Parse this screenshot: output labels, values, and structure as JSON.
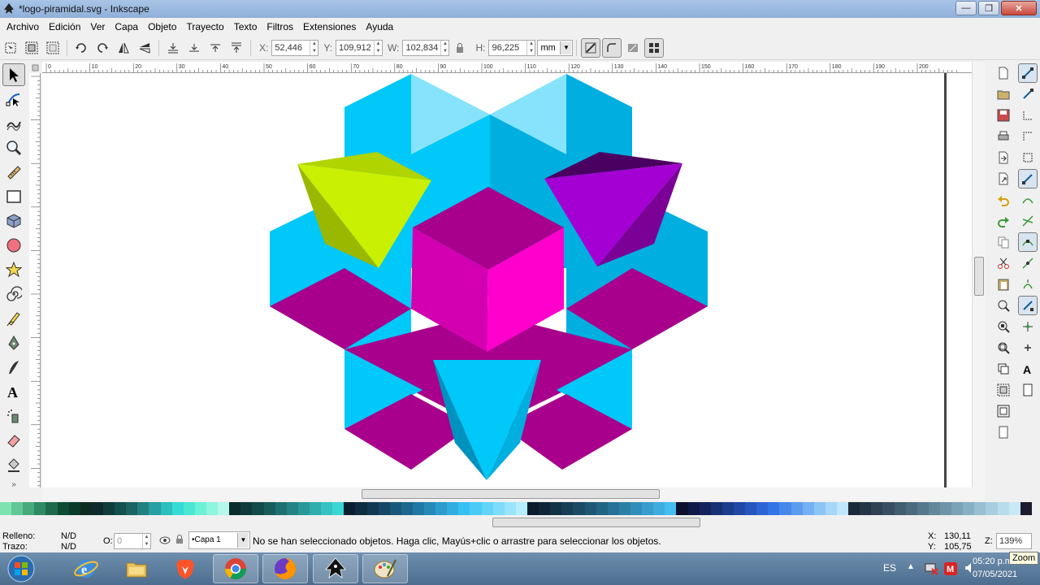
{
  "window": {
    "title": "*logo-piramidal.svg - Inkscape",
    "minimize": "—",
    "maximize": "❐",
    "close": "✕"
  },
  "menu": [
    {
      "id": "archivo",
      "label": "Archivo"
    },
    {
      "id": "edicion",
      "label": "Edición"
    },
    {
      "id": "ver",
      "label": "Ver"
    },
    {
      "id": "capa",
      "label": "Capa"
    },
    {
      "id": "objeto",
      "label": "Objeto"
    },
    {
      "id": "trayecto",
      "label": "Trayecto"
    },
    {
      "id": "texto",
      "label": "Texto"
    },
    {
      "id": "filtros",
      "label": "Filtros"
    },
    {
      "id": "extensiones",
      "label": "Extensiones"
    },
    {
      "id": "ayuda",
      "label": "Ayuda"
    }
  ],
  "toolcontrols": {
    "x_label": "X:",
    "x_value": "52,446",
    "y_label": "Y:",
    "y_value": "109,912",
    "w_label": "W:",
    "w_value": "102,834",
    "h_label": "H:",
    "h_value": "96,225",
    "unit": "mm"
  },
  "ruler": {
    "top_labels": [
      "0",
      "10",
      "20",
      "30",
      "40",
      "50",
      "60",
      "70",
      "80",
      "90",
      "100",
      "110",
      "120",
      "130",
      "140",
      "150",
      "160",
      "170",
      "180",
      "190",
      "200"
    ]
  },
  "status": {
    "fill_label": "Relleno:",
    "fill_value": "N/D",
    "stroke_label": "Trazo:",
    "stroke_value": "N/D",
    "opacity_label": "O:",
    "opacity_value": "0",
    "layer": "•Capa 1",
    "message": "No se han seleccionado objetos. Haga clic, Mayús+clic o arrastre para seleccionar los objetos.",
    "cursor_x_label": "X:",
    "cursor_x": "130,11",
    "cursor_y_label": "Y:",
    "cursor_y": "105,75",
    "zoom_label": "Z:",
    "zoom_value": "139%",
    "zoom_tooltip": "Zoom"
  },
  "taskbar": {
    "language": "ES",
    "time": "05:20 p.m.",
    "date": "07/05/2021"
  },
  "colors": {
    "cyan": "#00c8f8",
    "cyan_mid": "#00aee0",
    "cyan_dark": "#0092bf",
    "cyan_light": "#86e3fb",
    "magenta_dark": "#a8008c",
    "magenta_mid": "#d200b0",
    "magenta": "#ff00cc",
    "lime": "#c8f000",
    "lime_dark": "#9ab800",
    "lime_top": "#b0d400",
    "purple": "#a400d4",
    "purple_dark": "#7a0096",
    "purple_top": "#4a0060"
  }
}
